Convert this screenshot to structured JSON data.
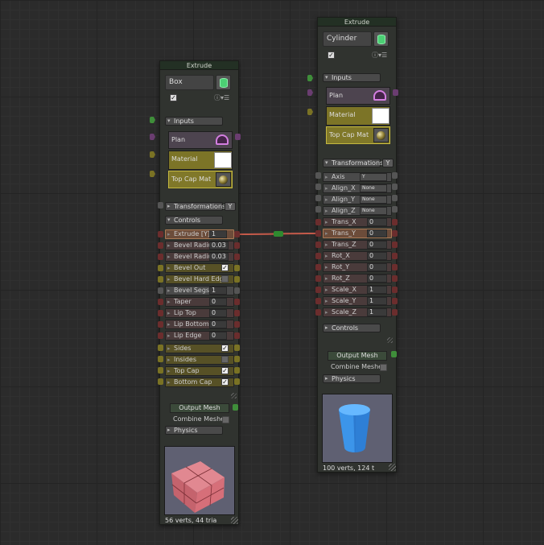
{
  "colors": {
    "canvas_bg": "#2b2b2b",
    "node_bg": "#30332f",
    "header_bg": "#233024",
    "port_red": "#6b2d2d",
    "port_yellow": "#7a7224",
    "port_green": "#3f8e3a",
    "port_purple": "#6a3d70",
    "wire": "#c45a4a"
  },
  "left_node": {
    "title": "Extrude",
    "name": "Box",
    "type_icon": "cylinder-icon",
    "enabled_mark": "✓",
    "info_icons": "ⓘ▾☰",
    "inputs_label": "Inputs",
    "plan_label": "Plan",
    "material_label": "Material",
    "topcap_label": "Top Cap Mat",
    "transformations_label": "Transformations",
    "transformations_axis": "Y",
    "controls_label": "Controls",
    "params": [
      {
        "label": "Extrude [Y]",
        "value": "1"
      },
      {
        "label": "Bevel Radius",
        "value": "0.03"
      },
      {
        "label": "Bevel Radius",
        "value": "0.03"
      },
      {
        "label": "Bevel Out",
        "check": "✓"
      },
      {
        "label": "Bevel Hard Edge",
        "check": ""
      },
      {
        "label": "Bevel Segs",
        "value": "1"
      },
      {
        "label": "Taper",
        "value": "0"
      },
      {
        "label": "Lip Top",
        "value": "0"
      },
      {
        "label": "Lip Bottom",
        "value": "0"
      },
      {
        "label": "Lip Edge",
        "value": "0"
      },
      {
        "label": "Sides",
        "check": "✓"
      },
      {
        "label": "Insides",
        "check": ""
      },
      {
        "label": "Top Cap",
        "check": "✓"
      },
      {
        "label": "Bottom Cap",
        "check": "✓"
      }
    ],
    "output_mesh_label": "Output Mesh",
    "combine_label": "Combine Meshe",
    "physics_label": "Physics",
    "stats": "56 verts, 44 tria"
  },
  "right_node": {
    "title": "Extrude",
    "name": "Cylinder",
    "type_icon": "cylinder-icon",
    "enabled_mark": "✓",
    "info_icons": "ⓘ▾☰",
    "inputs_label": "Inputs",
    "plan_label": "Plan",
    "material_label": "Material",
    "topcap_label": "Top Cap Mat",
    "transformations_label": "Transformations",
    "transformations_axis": "Y",
    "params": [
      {
        "label": "Axis",
        "value": "Y"
      },
      {
        "label": "Align_X",
        "value": "None"
      },
      {
        "label": "Align_Y",
        "value": "None"
      },
      {
        "label": "Align_Z",
        "value": "None"
      },
      {
        "label": "Trans_X",
        "value": "0"
      },
      {
        "label": "Trans_Y",
        "value": "0"
      },
      {
        "label": "Trans_Z",
        "value": "0"
      },
      {
        "label": "Rot_X",
        "value": "0"
      },
      {
        "label": "Rot_Y",
        "value": "0"
      },
      {
        "label": "Rot_Z",
        "value": "0"
      },
      {
        "label": "Scale_X",
        "value": "1"
      },
      {
        "label": "Scale_Y",
        "value": "1"
      },
      {
        "label": "Scale_Z",
        "value": "1"
      }
    ],
    "controls_label": "Controls",
    "output_mesh_label": "Output Mesh",
    "combine_label": "Combine Meshe",
    "physics_label": "Physics",
    "stats": "100 verts, 124 t"
  }
}
